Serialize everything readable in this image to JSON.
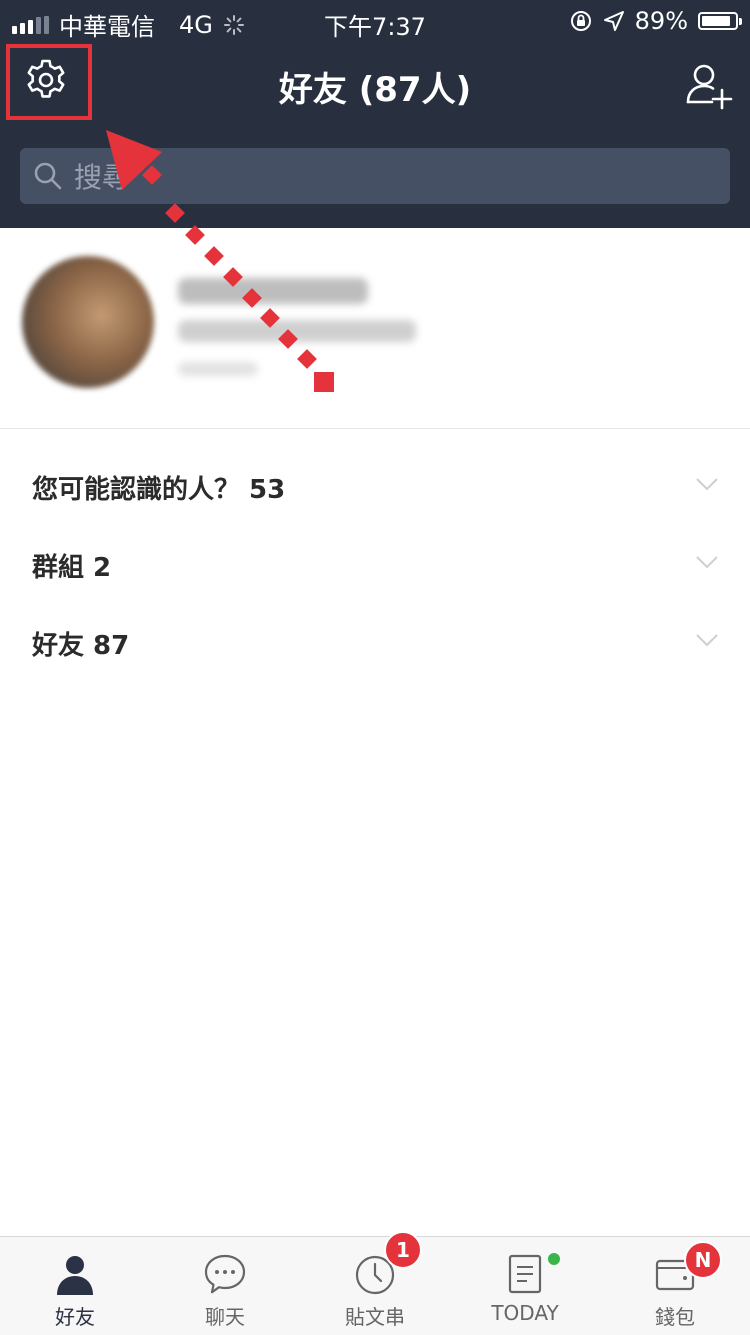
{
  "status_bar": {
    "carrier": "中華電信",
    "network": "4G",
    "time": "下午7:37",
    "battery": "89%",
    "battery_level": 0.89,
    "icons": [
      "signal-icon",
      "loading-icon",
      "orientation-lock-icon",
      "location-icon",
      "battery-icon"
    ]
  },
  "header": {
    "title": "好友 (87人)",
    "left_icon": "gear-icon",
    "right_icon": "add-friend-icon"
  },
  "search": {
    "placeholder": "搜尋"
  },
  "sections": [
    {
      "label": "您可能認識的人？ 53"
    },
    {
      "label": "群組 2"
    },
    {
      "label": "好友 87"
    }
  ],
  "tabs": [
    {
      "label": "好友",
      "icon": "person-icon",
      "active": true
    },
    {
      "label": "聊天",
      "icon": "chat-bubble-icon"
    },
    {
      "label": "貼文串",
      "icon": "clock-icon",
      "badge": "1"
    },
    {
      "label": "TODAY",
      "icon": "news-icon",
      "dot": true
    },
    {
      "label": "錢包",
      "icon": "wallet-icon",
      "badge": "N"
    }
  ],
  "colors": {
    "header_bg": "#283040",
    "accent_red": "#e5333c",
    "online_green": "#3ab54a"
  }
}
